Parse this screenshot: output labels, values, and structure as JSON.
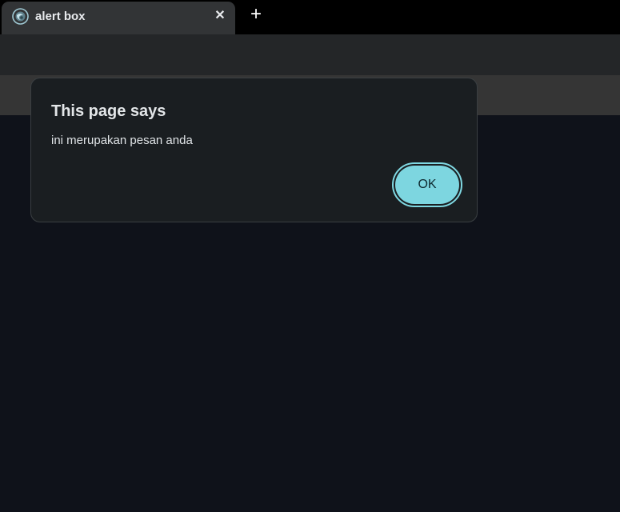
{
  "tab": {
    "title": "alert box",
    "favicon": "globe-spiral-icon",
    "close_glyph": "✕"
  },
  "new_tab": {
    "glyph": "+"
  },
  "dialog": {
    "title": "This page says",
    "message": "ini merupakan pesan anda",
    "ok_label": "OK"
  },
  "colors": {
    "accent": "#7dd6e0",
    "page_background": "#0f121a",
    "dialog_background": "#1a1e21"
  }
}
